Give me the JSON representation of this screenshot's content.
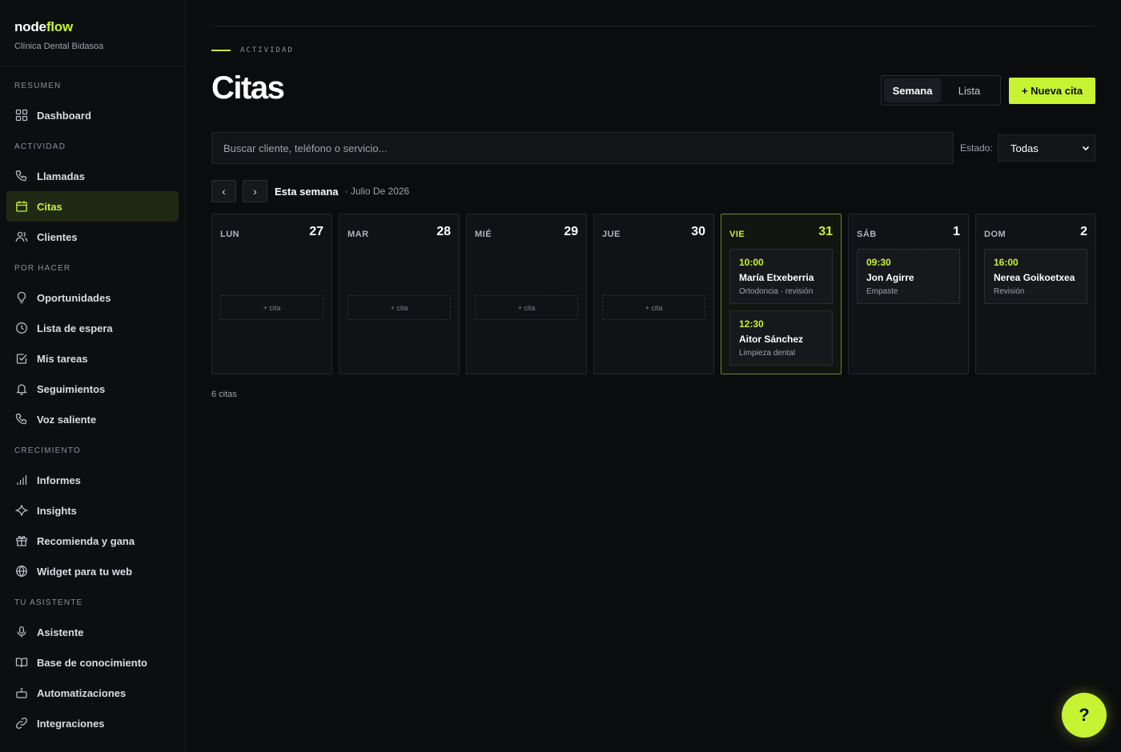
{
  "brand": {
    "name_a": "node",
    "name_b": "flow",
    "subtitle": "Clínica Dental Bidasoa"
  },
  "sidebar": {
    "sections": [
      {
        "title": "RESUMEN",
        "items": [
          {
            "label": "Dashboard",
            "icon": "grid-icon"
          }
        ]
      },
      {
        "title": "ACTIVIDAD",
        "items": [
          {
            "label": "Llamadas",
            "icon": "phone-icon"
          },
          {
            "label": "Citas",
            "icon": "calendar-icon",
            "active": true
          },
          {
            "label": "Clientes",
            "icon": "users-icon"
          }
        ]
      },
      {
        "title": "POR HACER",
        "items": [
          {
            "label": "Oportunidades",
            "icon": "lightbulb-icon"
          },
          {
            "label": "Lista de espera",
            "icon": "clock-icon"
          },
          {
            "label": "Mis tareas",
            "icon": "checkbox-icon"
          },
          {
            "label": "Seguimientos",
            "icon": "bell-icon"
          },
          {
            "label": "Voz saliente",
            "icon": "phone-outgoing-icon"
          }
        ]
      },
      {
        "title": "CRECIMIENTO",
        "items": [
          {
            "label": "Informes",
            "icon": "bar-chart-icon"
          },
          {
            "label": "Insights",
            "icon": "sparkle-icon"
          },
          {
            "label": "Recomienda y gana",
            "icon": "gift-icon"
          },
          {
            "label": "Widget para tu web",
            "icon": "globe-icon"
          }
        ]
      },
      {
        "title": "TU ASISTENTE",
        "items": [
          {
            "label": "Asistente",
            "icon": "microphone-icon"
          },
          {
            "label": "Base de conocimiento",
            "icon": "book-icon"
          },
          {
            "label": "Automatizaciones",
            "icon": "bot-icon"
          },
          {
            "label": "Integraciones",
            "icon": "link-icon"
          }
        ]
      }
    ]
  },
  "header": {
    "eyebrow": "ACTIVIDAD",
    "title": "Citas",
    "view_week": "Semana",
    "view_list": "Lista",
    "new_button": "+ Nueva cita"
  },
  "filters": {
    "search_placeholder": "Buscar cliente, teléfono o servicio...",
    "estado_label": "Estado:",
    "estado_value": "Todas"
  },
  "week": {
    "prev": "‹",
    "next": "›",
    "label": "Esta semana",
    "sub": "· Julio De 2026"
  },
  "days": [
    {
      "dow": "LUN",
      "num": "27",
      "add": "+ cita"
    },
    {
      "dow": "MAR",
      "num": "28",
      "add": "+ cita"
    },
    {
      "dow": "MIÉ",
      "num": "29",
      "add": "+ cita"
    },
    {
      "dow": "JUE",
      "num": "30",
      "add": "+ cita"
    },
    {
      "dow": "VIE",
      "num": "31",
      "today": true,
      "appts": [
        {
          "time": "10:00",
          "name": "María Etxeberria",
          "service": "Ortodoncia · revisión"
        },
        {
          "time": "12:30",
          "name": "Aitor Sánchez",
          "service": "Limpieza dental"
        }
      ]
    },
    {
      "dow": "SÁB",
      "num": "1",
      "appts": [
        {
          "time": "09:30",
          "name": "Jon Agirre",
          "service": "Empaste",
          "pending": true
        }
      ]
    },
    {
      "dow": "DOM",
      "num": "2",
      "appts": [
        {
          "time": "16:00",
          "name": "Nerea Goikoetxea",
          "service": "Revisión"
        }
      ]
    }
  ],
  "count": "6 citas",
  "help": "?",
  "colors": {
    "accent": "#c6f432",
    "background": "#0b0c0e",
    "active_nav_bg": "#1f2a14"
  }
}
